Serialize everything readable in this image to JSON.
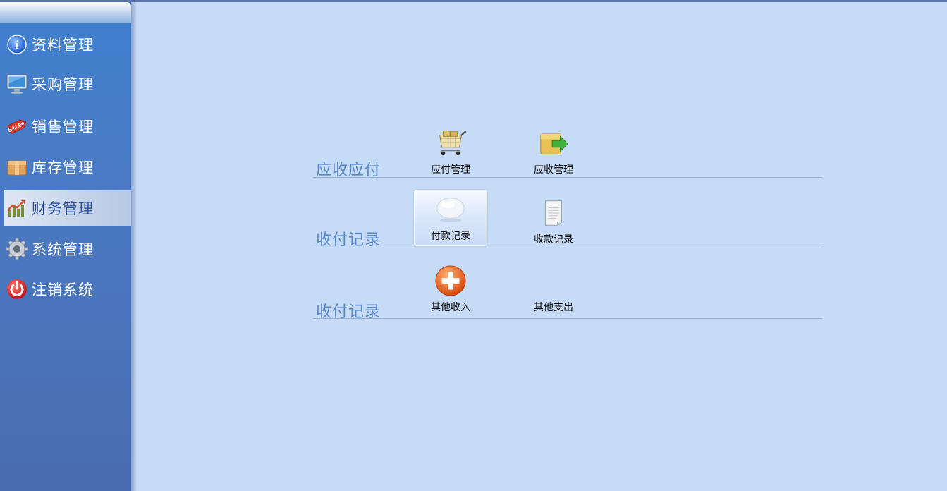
{
  "sidebar": {
    "items": [
      {
        "label": "资料管理",
        "icon": "info-icon"
      },
      {
        "label": "采购管理",
        "icon": "monitor-icon"
      },
      {
        "label": "销售管理",
        "icon": "sale-tag-icon"
      },
      {
        "label": "库存管理",
        "icon": "box-icon"
      },
      {
        "label": "财务管理",
        "icon": "chart-icon",
        "active": true
      },
      {
        "label": "系统管理",
        "icon": "gear-icon"
      },
      {
        "label": "注销系统",
        "icon": "power-icon"
      }
    ]
  },
  "main": {
    "sections": [
      {
        "title": "应收应付",
        "tiles": [
          {
            "label": "应付管理",
            "icon": "shopping-cart-icon"
          },
          {
            "label": "应收管理",
            "icon": "folder-arrow-icon"
          }
        ]
      },
      {
        "title": "收付记录",
        "tiles": [
          {
            "label": "付款记录",
            "icon": "speech-bubble-icon",
            "active": true
          },
          {
            "label": "收款记录",
            "icon": "document-icon"
          }
        ]
      },
      {
        "title": "收付记录",
        "tiles": [
          {
            "label": "其他收入",
            "icon": "add-circle-icon"
          },
          {
            "label": "其他支出",
            "icon": ""
          }
        ]
      }
    ]
  },
  "colors": {
    "background": "#c6dbf5",
    "sidebar": "#4a7bc4",
    "section_title": "#5a87c8",
    "add_icon": "#e8601c"
  }
}
